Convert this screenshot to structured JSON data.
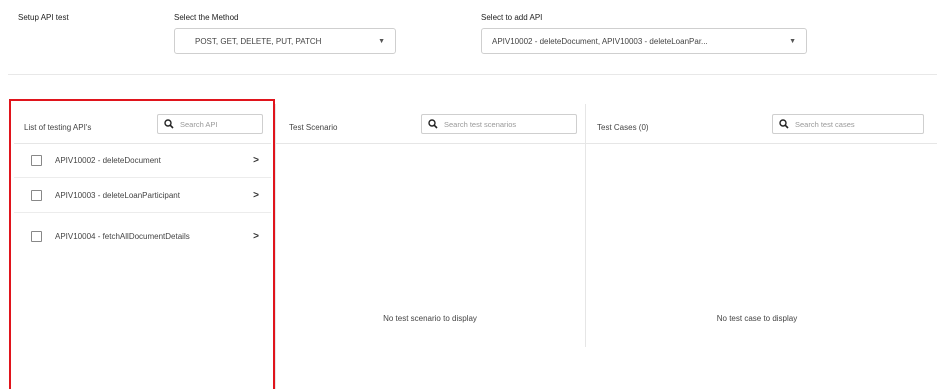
{
  "setup": {
    "title": "Setup API test"
  },
  "method": {
    "label": "Select the Method",
    "value": "POST, GET, DELETE, PUT, PATCH"
  },
  "api_select": {
    "label": "Select to add API",
    "value": "APIV10002 - deleteDocument, APIV10003 - deleteLoanPar..."
  },
  "api_list": {
    "title": "List of testing API's",
    "search_placeholder": "Search API",
    "items": [
      {
        "label": "APIV10002 - deleteDocument"
      },
      {
        "label": "APIV10003 - deleteLoanParticipant"
      },
      {
        "label": "APIV10004 - fetchAllDocumentDetails"
      }
    ]
  },
  "scenarios": {
    "title": "Test Scenario",
    "search_placeholder": "Search test scenarios",
    "empty": "No test scenario to display"
  },
  "cases": {
    "title": "Test Cases (0)",
    "search_placeholder": "Search test cases",
    "empty": "No test case to display"
  },
  "colors": {
    "highlight": "#e0141c",
    "border": "#cfcfcf"
  }
}
